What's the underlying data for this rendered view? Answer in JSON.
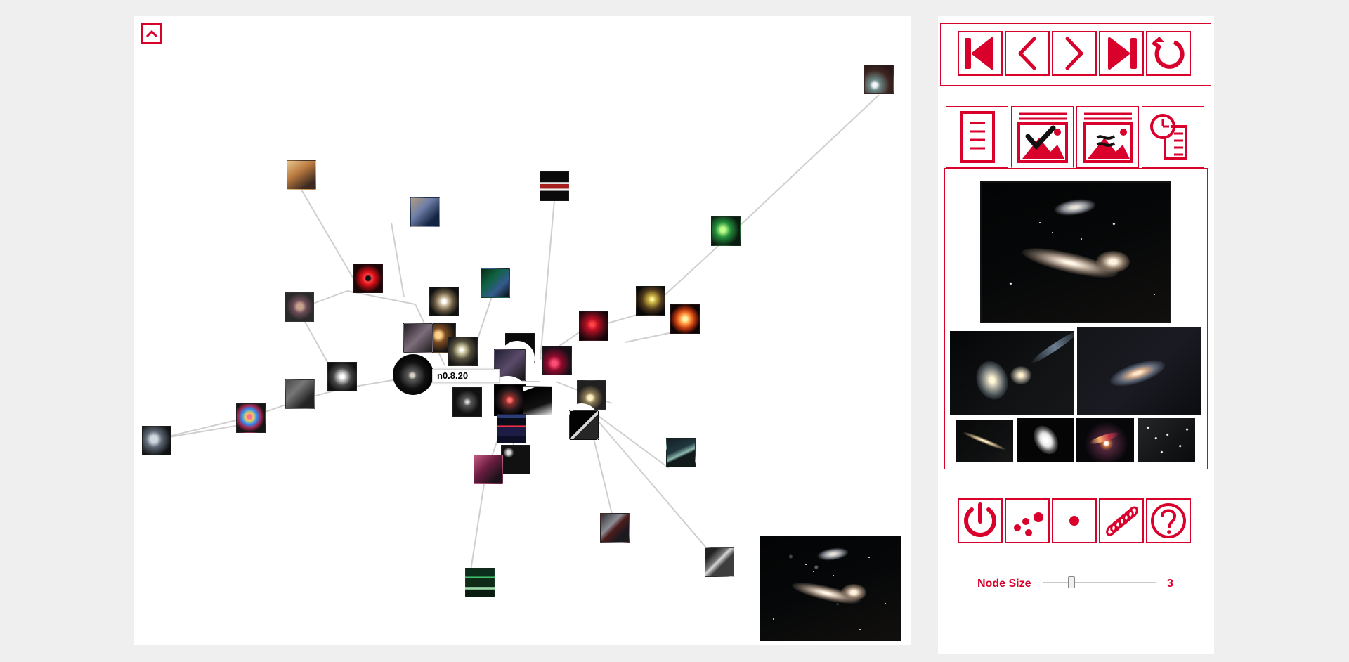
{
  "tooltip": {
    "label": "n0.8.20"
  },
  "graph": {
    "nodes": [
      "n0.8.20"
    ]
  },
  "toolbar": {
    "navigation": [
      "first-icon",
      "previous-icon",
      "next-icon",
      "last-icon",
      "refresh-icon"
    ],
    "tabs": [
      "document-icon",
      "image-checked-icon",
      "image-compare-icon",
      "history-icon"
    ],
    "controls": [
      "power-icon",
      "scatter-icon",
      "dot-icon",
      "spring-icon",
      "help-icon"
    ]
  },
  "node_size": {
    "label": "Node Size",
    "value": "3",
    "fraction": 0.24
  },
  "colors": {
    "accent": "#d9002c",
    "edge": "#c8c8c8",
    "panel": "#ffffff",
    "background": "#efefef"
  }
}
